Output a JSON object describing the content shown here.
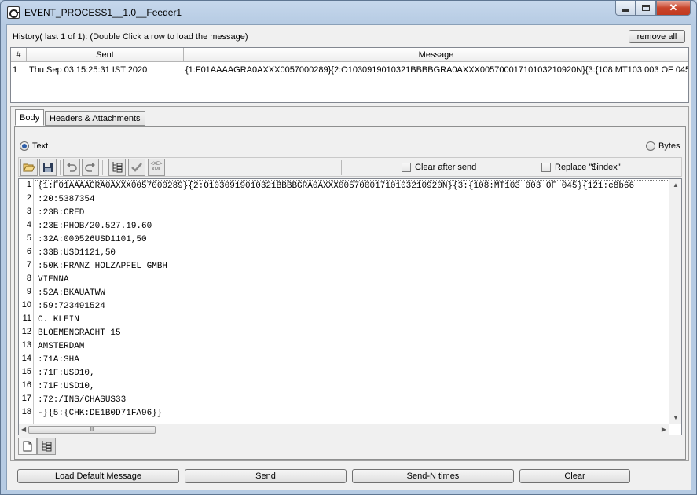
{
  "window": {
    "title": "EVENT_PROCESS1__1.0__Feeder1",
    "close_glyph": "✕"
  },
  "history": {
    "label": "History( last 1 of 1):   (Double Click a row to load the message)",
    "remove_all_label": "remove all",
    "columns": [
      "#",
      "Sent",
      "Message"
    ],
    "rows": [
      {
        "num": "1",
        "sent": "Thu Sep 03 15:25:31 IST 2020",
        "message": "{1:F01AAAAGRA0AXXX0057000289}{2:O1030919010321BBBBGRA0AXXX00570001710103210920N}{3:{108:MT103 003 OF 045..."
      }
    ]
  },
  "tabs": [
    "Body",
    "Headers & Attachments"
  ],
  "body": {
    "text_radio_label": "Text",
    "bytes_radio_label": "Bytes",
    "clear_after_send_label": "Clear after send",
    "replace_index_label": "Replace \"$index\"",
    "xml_icon_text": "<XE>\nXML"
  },
  "editor": {
    "lines": [
      "{1:F01AAAAGRA0AXXX0057000289}{2:O1030919010321BBBBGRA0AXXX00570001710103210920N}{3:{108:MT103 003 OF 045}{121:c8b66",
      ":20:5387354",
      ":23B:CRED",
      ":23E:PHOB/20.527.19.60",
      ":32A:000526USD1101,50",
      ":33B:USD1121,50",
      ":50K:FRANZ HOLZAPFEL GMBH",
      "VIENNA",
      ":52A:BKAUATWW",
      ":59:723491524",
      "C. KLEIN",
      "BLOEMENGRACHT 15",
      "AMSTERDAM",
      ":71A:SHA",
      ":71F:USD10,",
      ":71F:USD10,",
      ":72:/INS/CHASUS33",
      "-}{5:{CHK:DE1B0D71FA96}}"
    ],
    "thumb_grip": "lll"
  },
  "buttons": {
    "load_default": "Load Default Message",
    "send": "Send",
    "send_n": "Send-N times",
    "clear": "Clear"
  }
}
